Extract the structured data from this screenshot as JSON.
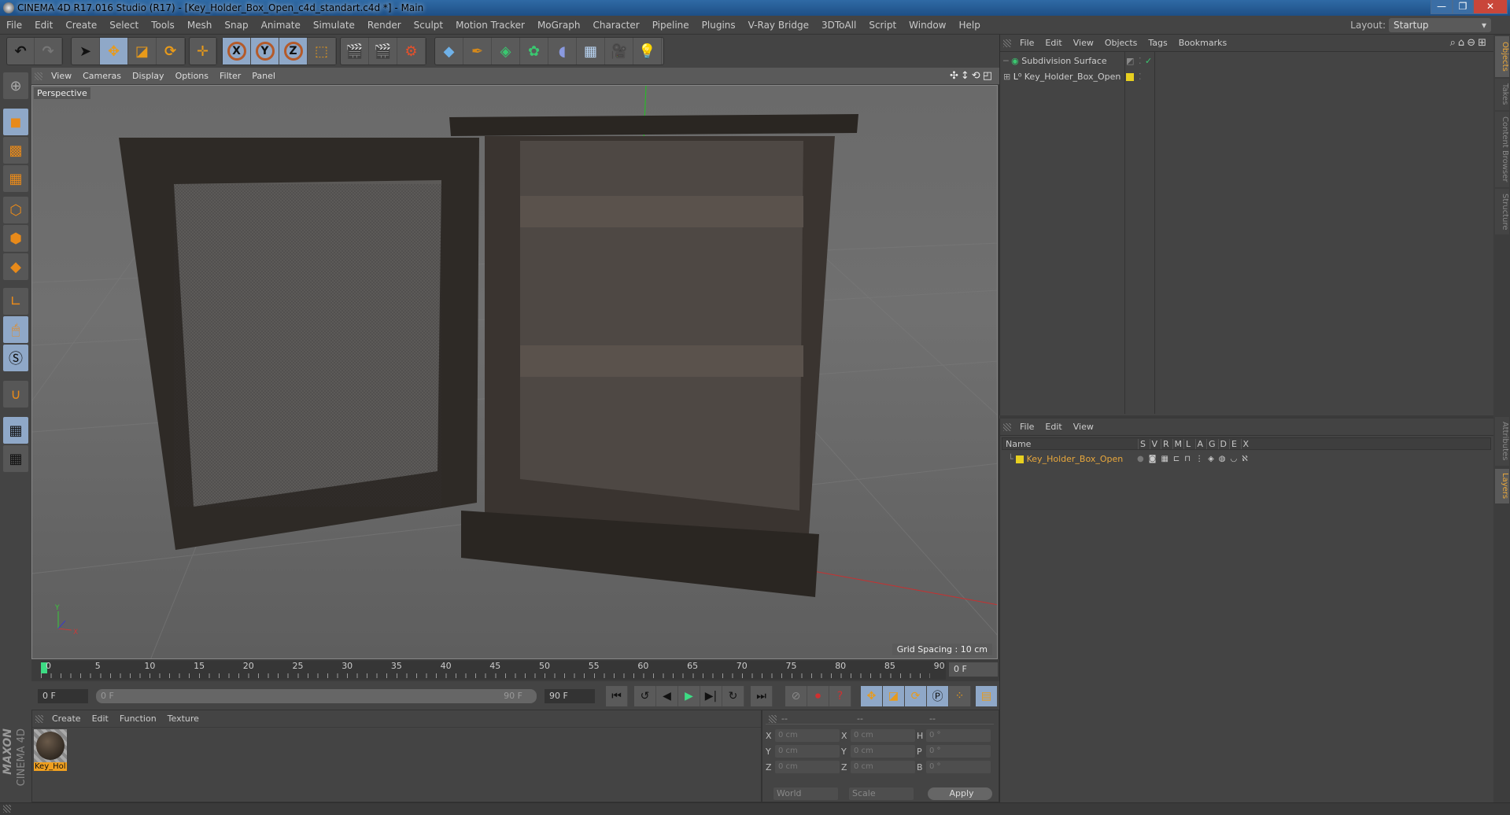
{
  "window": {
    "title": "CINEMA 4D R17.016 Studio (R17) - [Key_Holder_Box_Open_c4d_standart.c4d *] - Main",
    "minimize": "—",
    "restore": "❐",
    "close": "✕"
  },
  "menubar": {
    "items": [
      "File",
      "Edit",
      "Create",
      "Select",
      "Tools",
      "Mesh",
      "Snap",
      "Animate",
      "Simulate",
      "Render",
      "Sculpt",
      "Motion Tracker",
      "MoGraph",
      "Character",
      "Pipeline",
      "Plugins",
      "V-Ray Bridge",
      "3DToAll",
      "Script",
      "Window",
      "Help"
    ],
    "layout_label": "Layout:",
    "layout_value": "Startup"
  },
  "toolbar": {
    "undo": "↶",
    "redo": "↷",
    "select": "➤",
    "move": "✥",
    "scale": "◪",
    "rotate": "⟳",
    "xform": "✛",
    "x": "X",
    "y": "Y",
    "z": "Z",
    "coord": "⬚",
    "render_view": "🎬",
    "render_pic": "🎬",
    "render_settings": "⚙",
    "cube": "◆",
    "pen": "✒",
    "subdiv": "◈",
    "array": "✿",
    "deform": "◖",
    "floor": "▦",
    "camera": "🎥",
    "light": "💡"
  },
  "viewport": {
    "menu": [
      "View",
      "Cameras",
      "Display",
      "Options",
      "Filter",
      "Panel"
    ],
    "label": "Perspective",
    "grid_spacing": "Grid Spacing : 10 cm",
    "nav_icons": [
      "✣",
      "↕",
      "⟲",
      "◰"
    ]
  },
  "timeline": {
    "ticks": [
      "0",
      "5",
      "10",
      "15",
      "20",
      "25",
      "30",
      "35",
      "40",
      "45",
      "50",
      "55",
      "60",
      "65",
      "70",
      "75",
      "80",
      "85",
      "90"
    ],
    "current_frame": "0 F",
    "start": "0 F",
    "range_start": "0 F",
    "range_end": "90 F",
    "end": "90 F"
  },
  "transport": {
    "first": "⏮",
    "prev_key": "↺",
    "prev": "◀",
    "play": "▶",
    "next": "▶|",
    "next_key": "↻",
    "last": "⏭"
  },
  "material_manager": {
    "menu": [
      "Create",
      "Edit",
      "Function",
      "Texture"
    ],
    "materials": [
      {
        "name": "Key_Hol"
      }
    ]
  },
  "coordinates": {
    "headers": [
      "--",
      "--",
      "--"
    ],
    "rows": [
      {
        "l1": "X",
        "v1": "0 cm",
        "l2": "X",
        "v2": "0 cm",
        "l3": "H",
        "v3": "0 °"
      },
      {
        "l1": "Y",
        "v1": "0 cm",
        "l2": "Y",
        "v2": "0 cm",
        "l3": "P",
        "v3": "0 °"
      },
      {
        "l1": "Z",
        "v1": "0 cm",
        "l2": "Z",
        "v2": "0 cm",
        "l3": "B",
        "v3": "0 °"
      }
    ],
    "mode": "World",
    "type": "Scale",
    "apply": "Apply"
  },
  "object_manager": {
    "menu": [
      "File",
      "Edit",
      "View",
      "Objects",
      "Tags",
      "Bookmarks"
    ],
    "objects": [
      {
        "name": "Subdivision Surface"
      },
      {
        "name": "Key_Holder_Box_Open"
      }
    ]
  },
  "layer_manager": {
    "menu": [
      "File",
      "Edit",
      "View"
    ],
    "columns": [
      "Name",
      "S",
      "V",
      "R",
      "M",
      "L",
      "A",
      "G",
      "D",
      "E",
      "X"
    ],
    "layers": [
      {
        "name": "Key_Holder_Box_Open",
        "color": "#e8d020"
      }
    ]
  },
  "right_tabs": [
    "Objects",
    "Takes",
    "Content Browser",
    "Structure",
    "Attributes",
    "Layers"
  ],
  "branding": {
    "maxon": "MAXON",
    "product": "CINEMA 4D"
  },
  "colors": {
    "accent_orange": "#e8a73c",
    "active_blue": "#8fa8c8",
    "layer_yellow": "#e8d020",
    "playhead_green": "#3ddc84"
  }
}
